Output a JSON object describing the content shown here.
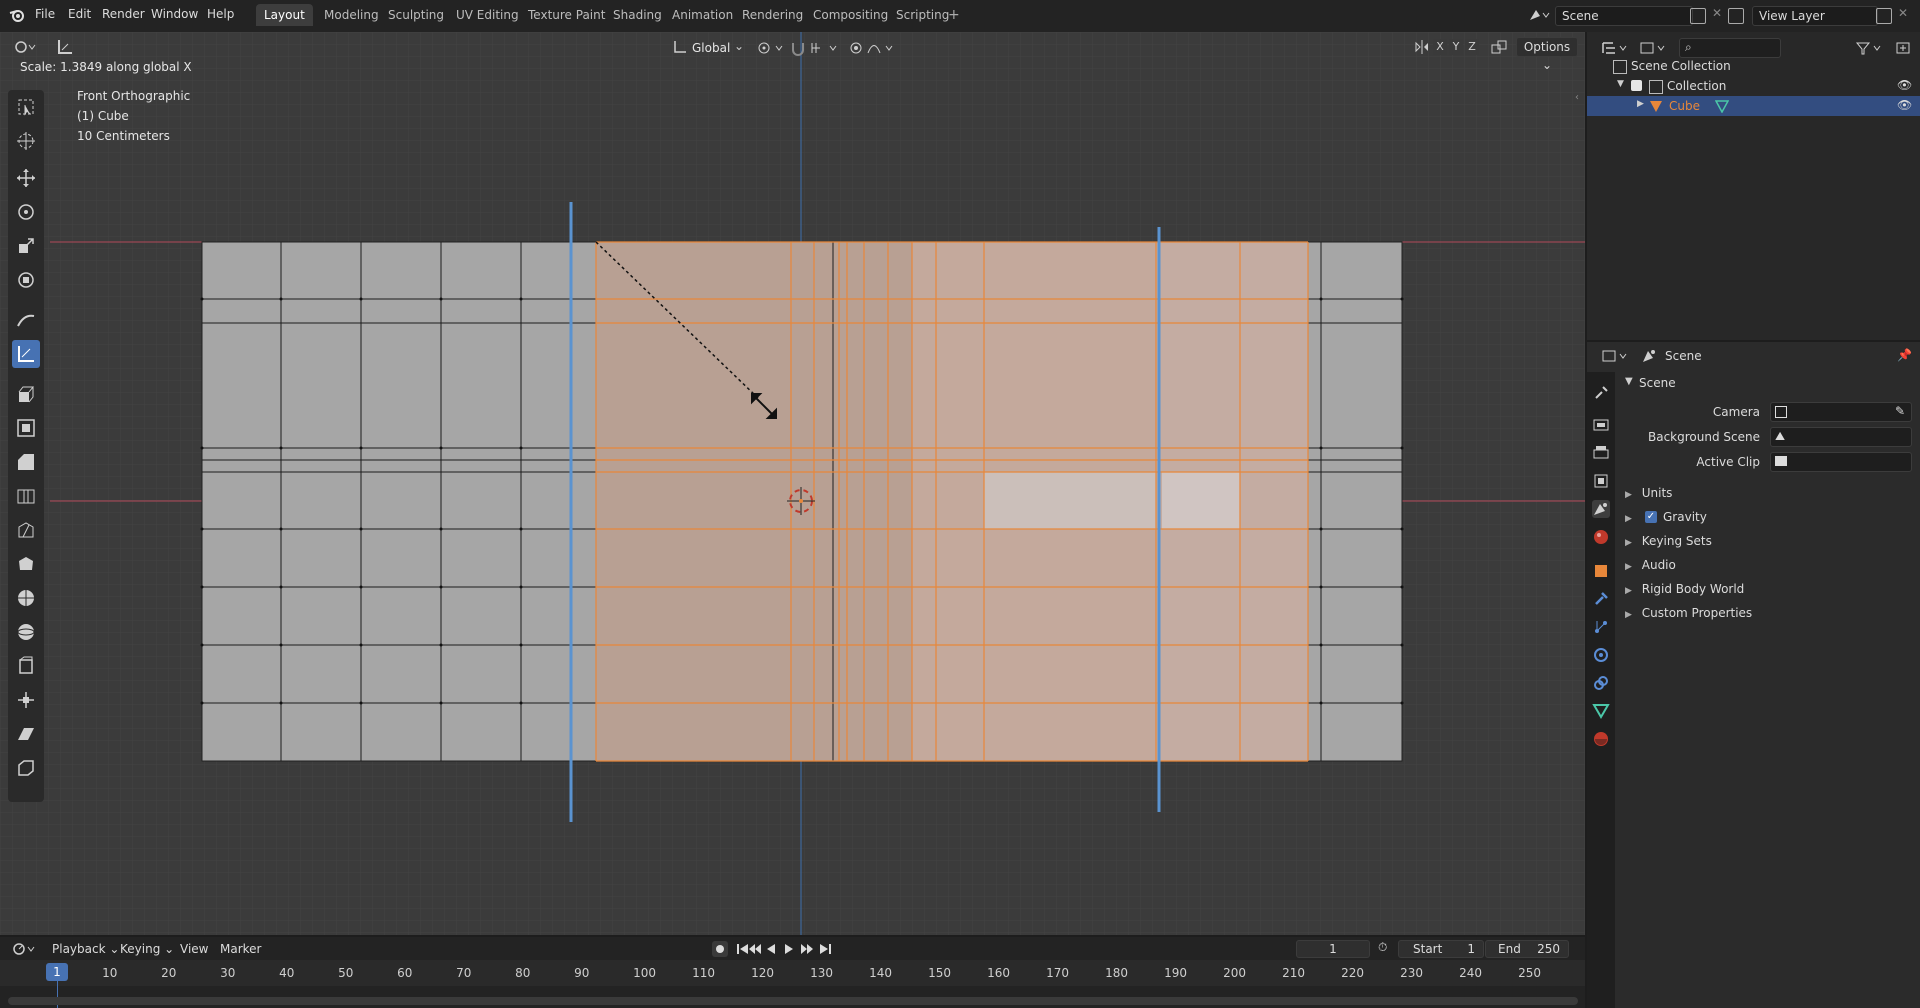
{
  "menubar": {
    "items": [
      "File",
      "Edit",
      "Render",
      "Window",
      "Help"
    ],
    "workspaces": [
      "Layout",
      "Modeling",
      "Sculpting",
      "UV Editing",
      "Texture Paint",
      "Shading",
      "Animation",
      "Rendering",
      "Compositing",
      "Scripting"
    ],
    "active_workspace": "Layout",
    "scene_name": "Scene",
    "view_layer": "View Layer"
  },
  "viewport": {
    "status": "Scale: 1.3849 along global X",
    "view_name": "Front Orthographic",
    "object_label": "(1) Cube",
    "grid_scale": "10 Centimeters",
    "orientation": "Global",
    "axes": [
      "X",
      "Y",
      "Z"
    ],
    "options_label": "Options",
    "selection_color": "#e8873a",
    "axis_x_color": "#c8485a",
    "axis_z_color": "#3c7fc8"
  },
  "outliner": {
    "search_placeholder": "",
    "items": [
      {
        "label": "Scene Collection",
        "icon": "collection-icon"
      },
      {
        "label": "Collection",
        "icon": "collection-icon"
      },
      {
        "label": "Cube",
        "icon": "mesh-icon",
        "selected": true
      }
    ]
  },
  "properties": {
    "header": "Scene",
    "section": "Scene",
    "fields": [
      {
        "label": "Camera",
        "value": ""
      },
      {
        "label": "Background Scene",
        "value": ""
      },
      {
        "label": "Active Clip",
        "value": ""
      }
    ],
    "panels": [
      "Units",
      "Gravity",
      "Keying Sets",
      "Audio",
      "Rigid Body World",
      "Custom Properties"
    ],
    "gravity_checked": true
  },
  "timeline": {
    "menus": [
      "Playback",
      "Keying",
      "View",
      "Marker"
    ],
    "current_frame": "1",
    "start_label": "Start",
    "start": "1",
    "end_label": "End",
    "end": "250",
    "ticks": [
      "1",
      "10",
      "20",
      "30",
      "40",
      "50",
      "60",
      "70",
      "80",
      "90",
      "100",
      "110",
      "120",
      "130",
      "140",
      "150",
      "160",
      "170",
      "180",
      "190",
      "200",
      "210",
      "220",
      "230",
      "240",
      "250"
    ]
  }
}
